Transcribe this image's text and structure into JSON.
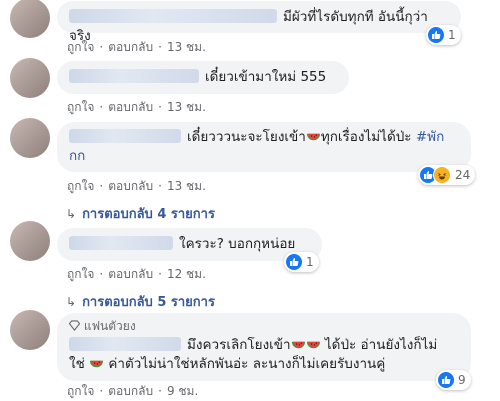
{
  "actions": {
    "like": "ถูกใจ",
    "reply": "ตอบกลับ"
  },
  "comments": [
    {
      "text": "มีผัวที่ไรดับทุกที อันนี้กุว่าจริง",
      "time": "13 ชม.",
      "reaction_count": "1"
    },
    {
      "text": "เดี๋ยวเข้ามาใหม่ 555",
      "time": "13 ชม."
    },
    {
      "text_a": "เดี๋ยวววนะจะโยงเข้า",
      "text_b": "ทุกเรื่องไม่ได้ป่ะ",
      "hashtag_a": "#พัก",
      "hashtag_b": "กก",
      "time": "13 ชม.",
      "reaction_count": "24",
      "replies": "การตอบกลับ 4 รายการ"
    },
    {
      "text": "ใครวะ? บอกกุหน่อย",
      "time": "12 ชม.",
      "reaction_count": "1",
      "replies": "การตอบกลับ 5 รายการ"
    },
    {
      "badge": "แฟนตัวยง",
      "text_a": "มึงควรเลิกโยงเข้า",
      "text_b": "ได้ป่ะ อ่านยังไงก็ไม่",
      "text_c": "ใช่",
      "text_d": "ค่าตัวไม่น่าใช่หลักพันอ่ะ ละนางก็ไม่เคยรับงานคู่",
      "time": "9 ชม.",
      "reaction_count": "9"
    }
  ],
  "icons": {
    "like": "thumbs-up-icon",
    "haha": "laughing-face-icon",
    "watermelon": "watermelon-icon",
    "badge": "diamond-icon",
    "reply_arrow": "reply-arrow-icon"
  },
  "colors": {
    "bubble": "#f2f3f5",
    "link": "#385898",
    "like": "#1877f2"
  }
}
